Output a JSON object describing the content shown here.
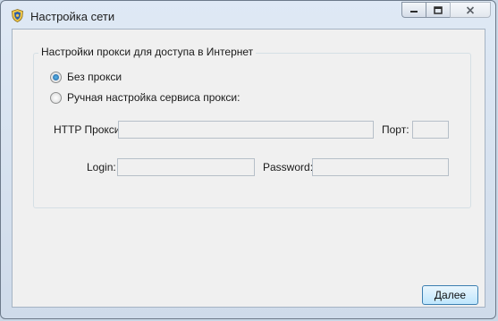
{
  "window": {
    "title": "Настройка сети"
  },
  "group": {
    "legend": "Настройки прокси для доступа в Интернет",
    "options": [
      {
        "label": "Без прокси",
        "selected": true
      },
      {
        "label": "Ручная настройка сервиса прокси:",
        "selected": false
      }
    ]
  },
  "fields": {
    "http_proxy": {
      "label": "HTTP Прокси:",
      "value": ""
    },
    "port": {
      "label": "Порт:",
      "value": ""
    },
    "login": {
      "label": "Login:",
      "value": ""
    },
    "password": {
      "label": "Password:",
      "value": ""
    }
  },
  "buttons": {
    "next": "Далее"
  },
  "icons": {
    "app": "shield-emblem-icon",
    "minimize": "minimize-icon",
    "maximize": "maximize-icon",
    "close": "close-icon"
  },
  "colors": {
    "accent": "#3c7fb1"
  }
}
